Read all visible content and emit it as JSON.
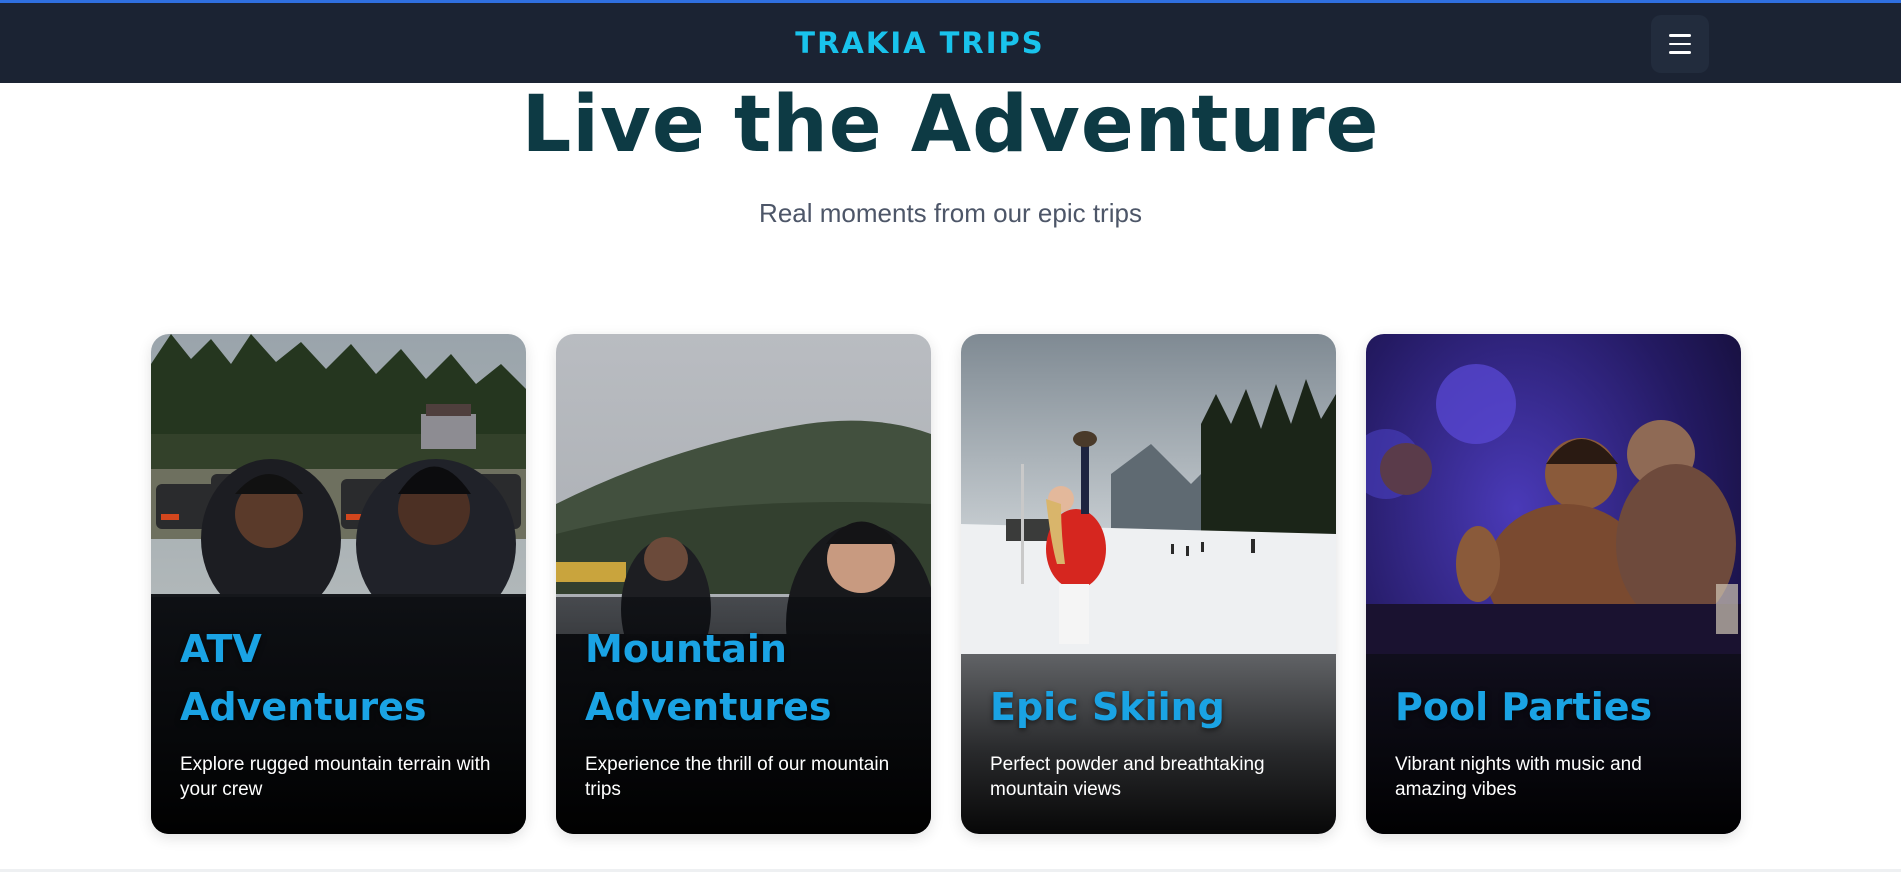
{
  "navbar": {
    "brand": "TRAKIA TRIPS",
    "menu_icon": "hamburger-menu-icon"
  },
  "hero": {
    "title": "Live the Adventure",
    "subtitle": "Real moments from our epic trips"
  },
  "cards": [
    {
      "title_line1": "ATV",
      "title_line2": "Adventures",
      "description": "Explore rugged mountain terrain with your crew"
    },
    {
      "title_line1": "Mountain",
      "title_line2": "Adventures",
      "description": "Experience the thrill of our mountain trips"
    },
    {
      "title_line1": "",
      "title_line2": "Epic Skiing",
      "description": "Perfect powder and breathtaking mountain views"
    },
    {
      "title_line1": "",
      "title_line2": "Pool Parties",
      "description": "Vibrant nights with music and amazing vibes"
    }
  ],
  "colors": {
    "navbar_bg": "#1b2333",
    "brand": "#19c3ec",
    "hero_title": "#0d3a44",
    "card_title": "#1aa3e4"
  }
}
